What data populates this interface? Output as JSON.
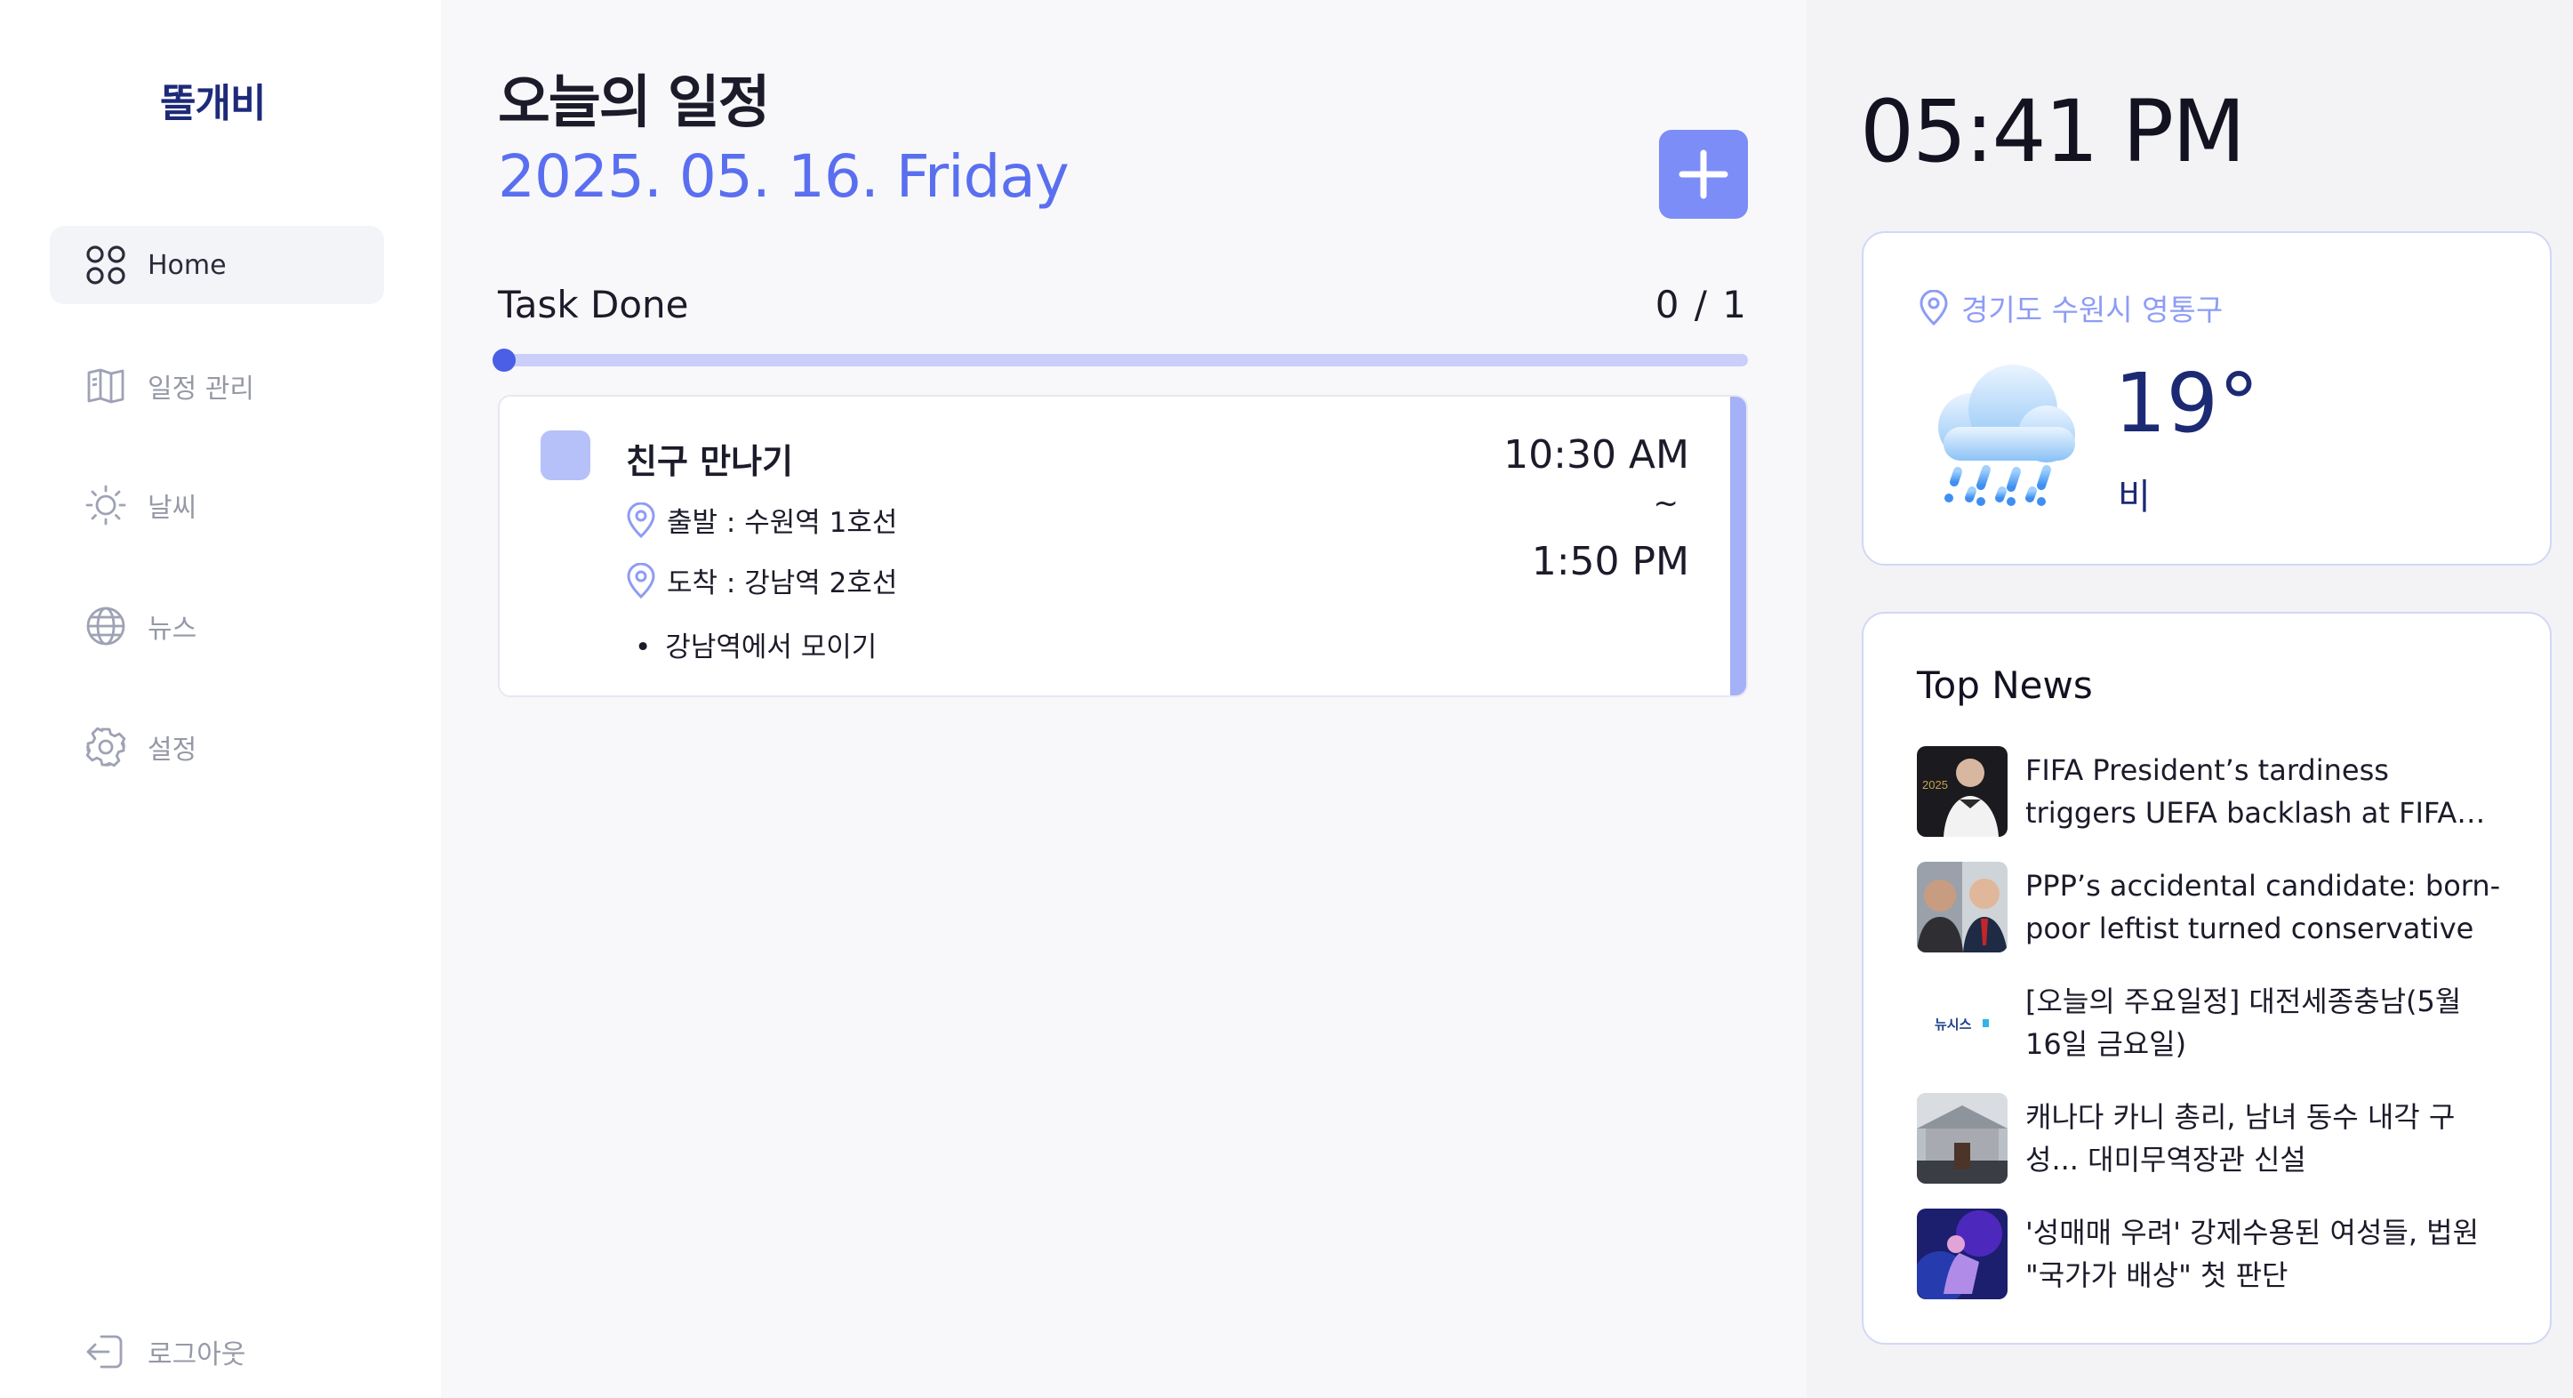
{
  "app": {
    "logo": "똘개비"
  },
  "sidebar": {
    "items": [
      {
        "label": "Home",
        "icon": "grid-icon",
        "active": true
      },
      {
        "label": "일정 관리",
        "icon": "book-icon",
        "active": false
      },
      {
        "label": "날씨",
        "icon": "sun-icon",
        "active": false
      },
      {
        "label": "뉴스",
        "icon": "globe-icon",
        "active": false
      },
      {
        "label": "설정",
        "icon": "gear-icon",
        "active": false
      }
    ],
    "logout_label": "로그아웃"
  },
  "main": {
    "title": "오늘의 일정",
    "date": "2025. 05. 16. Friday",
    "add_button": "+",
    "task_done_label": "Task Done",
    "task_count": "0 / 1",
    "progress": 0,
    "tasks": [
      {
        "title": "친구 만나기",
        "departure": "출발 : 수원역 1호선",
        "arrival": "도착 : 강남역 2호선",
        "note": "강남역에서 모이기",
        "start_time": "10:30 AM",
        "separator": "~",
        "end_time": "1:50 PM",
        "done": false
      }
    ]
  },
  "right": {
    "clock": "05:41 PM",
    "weather": {
      "location": "경기도 수원시 영통구",
      "temperature": "19°",
      "condition": "비",
      "icon": "rain-cloud-icon"
    },
    "news": {
      "title": "Top News",
      "items": [
        {
          "text": "FIFA President’s tardiness triggers UEFA backlash at FIFA Congress",
          "thumb": "speaker-photo"
        },
        {
          "text": "PPP’s accidental candidate: born-poor leftist turned conservative",
          "thumb": "politicians-photo"
        },
        {
          "text": "[오늘의 주요일정] 대전세종충남(5월 16일 금요일)",
          "thumb": "newsis-logo"
        },
        {
          "text": "캐나다 카니 총리, 남녀 동수 내각 구성... 대미무역장관 신설",
          "thumb": "parliament-photo"
        },
        {
          "text": "'성매매 우려' 강제수용된 여성들, 법원 \"국가가 배상\" 첫 판단",
          "thumb": "illustration"
        }
      ],
      "thumb_label_newsis": "뉴시스"
    }
  },
  "colors": {
    "accent": "#5a6ff0",
    "accent_light": "#7c8df7",
    "card_border": "#d2d7f6",
    "navy": "#1c2a74"
  }
}
